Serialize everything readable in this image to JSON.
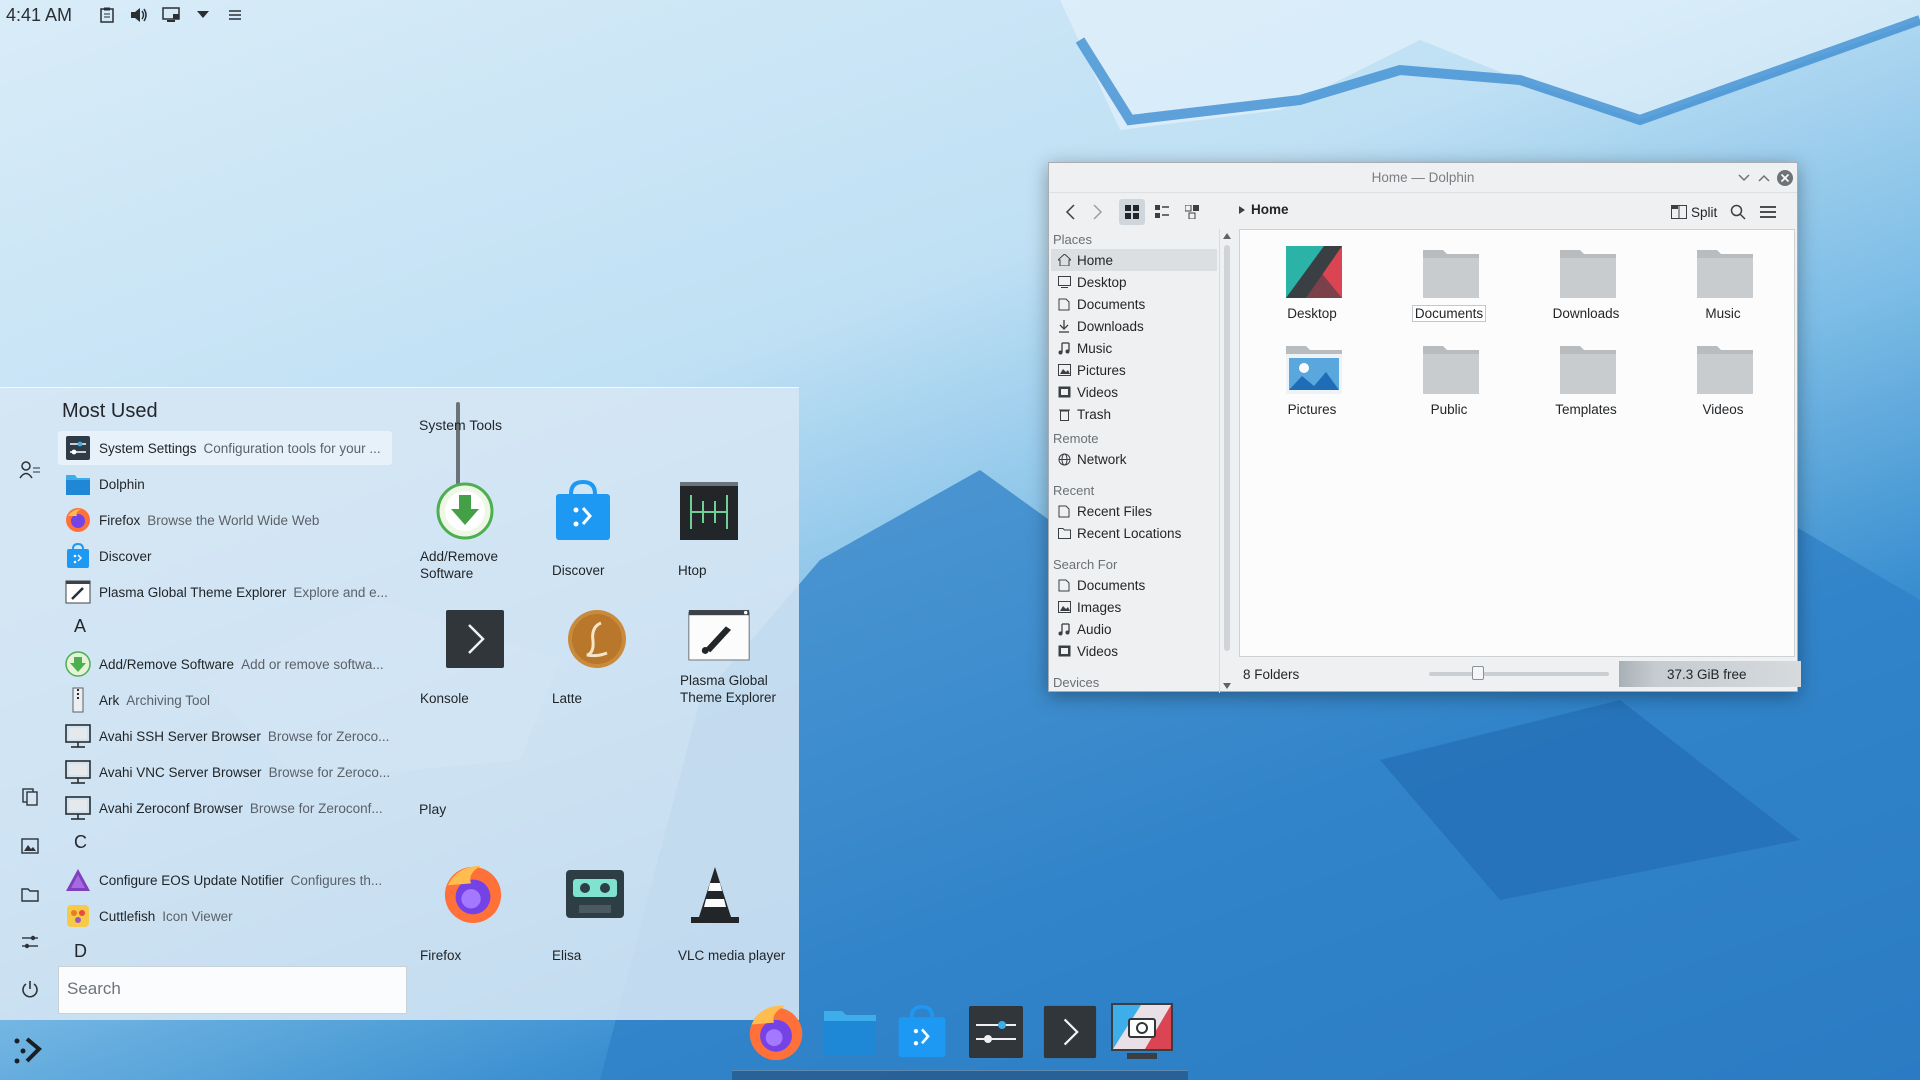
{
  "top_panel": {
    "clock": "4:41 AM",
    "tray_icons": [
      "clipboard-icon",
      "volume-icon",
      "display-icon",
      "expand-arrow-icon",
      "menu-icon"
    ]
  },
  "launcher": {
    "most_used_header": "Most Used",
    "search_placeholder": "Search",
    "sections": [
      {
        "title": "System Tools"
      },
      {
        "title": "Play"
      }
    ],
    "apps": [
      {
        "name": "System Settings",
        "desc": "Configuration tools for your ..."
      },
      {
        "name": "Dolphin",
        "desc": ""
      },
      {
        "name": "Firefox",
        "desc": "Browse the World Wide Web"
      },
      {
        "name": "Discover",
        "desc": ""
      },
      {
        "name": "Plasma Global Theme Explorer",
        "desc": "Explore and e..."
      },
      {
        "name": "Add/Remove Software",
        "desc": "Add or remove softwa..."
      },
      {
        "name": "Ark",
        "desc": "Archiving Tool"
      },
      {
        "name": "Avahi SSH Server Browser",
        "desc": "Browse for Zeroco..."
      },
      {
        "name": "Avahi VNC Server Browser",
        "desc": "Browse for Zeroco..."
      },
      {
        "name": "Avahi Zeroconf Browser",
        "desc": "Browse for Zeroconf..."
      },
      {
        "name": "Configure EOS Update Notifier",
        "desc": "Configures th..."
      },
      {
        "name": "Cuttlefish",
        "desc": "Icon Viewer"
      }
    ],
    "letters": [
      "A",
      "C",
      "D"
    ],
    "system_tools": [
      {
        "label": "Add/Remove Software"
      },
      {
        "label": "Discover"
      },
      {
        "label": "Htop"
      },
      {
        "label": "Konsole"
      },
      {
        "label": "Latte"
      },
      {
        "label": "Plasma Global Theme Explorer"
      }
    ],
    "play": [
      {
        "label": "Firefox"
      },
      {
        "label": "Elisa"
      },
      {
        "label": "VLC media player"
      }
    ]
  },
  "dolphin": {
    "title": "Home — Dolphin",
    "breadcrumb": "Home",
    "split_label": "Split",
    "places": {
      "places_head": "Places",
      "places_items": [
        "Home",
        "Desktop",
        "Documents",
        "Downloads",
        "Music",
        "Pictures",
        "Videos",
        "Trash"
      ],
      "remote_head": "Remote",
      "remote_items": [
        "Network"
      ],
      "recent_head": "Recent",
      "recent_items": [
        "Recent Files",
        "Recent Locations"
      ],
      "search_head": "Search For",
      "search_items": [
        "Documents",
        "Images",
        "Audio",
        "Videos"
      ],
      "devices_head": "Devices"
    },
    "files": [
      "Desktop",
      "Documents",
      "Downloads",
      "Music",
      "Pictures",
      "Public",
      "Templates",
      "Videos"
    ],
    "status": "8 Folders",
    "free_space": "37.3 GiB free",
    "zoom_level": 0.27,
    "accent": "#3daee9"
  },
  "dock": [
    "firefox-icon",
    "dolphin-icon",
    "discover-icon",
    "system-settings-icon",
    "konsole-icon",
    "spectacle-icon"
  ]
}
